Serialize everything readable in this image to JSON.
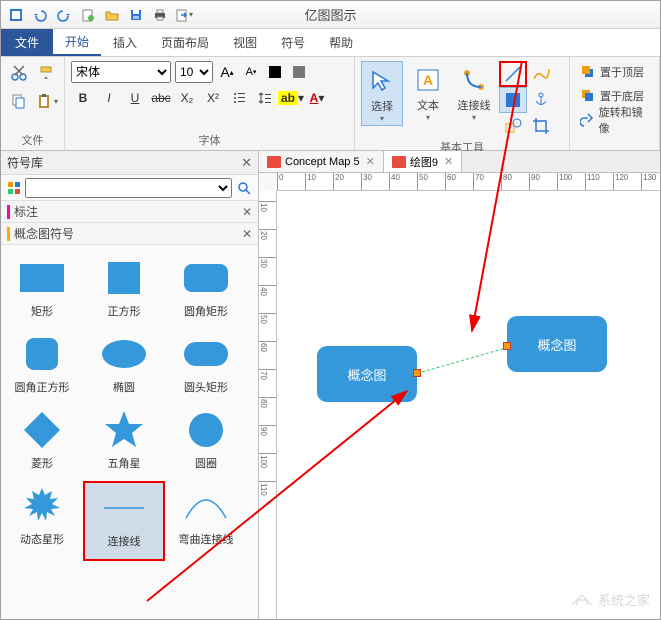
{
  "app_title": "亿图图示",
  "qat": [
    "app-menu",
    "undo",
    "redo",
    "new",
    "open",
    "save",
    "print",
    "export"
  ],
  "tabs": {
    "file": "文件",
    "items": [
      "开始",
      "插入",
      "页面布局",
      "视图",
      "符号",
      "帮助"
    ],
    "active": 0
  },
  "ribbon": {
    "clipboard": {
      "label": "文件"
    },
    "font": {
      "label": "字体",
      "name": "宋体",
      "size": "10",
      "btns": [
        "B",
        "I",
        "U",
        "abc",
        "X₂",
        "X²"
      ]
    },
    "tools": {
      "label": "基本工具",
      "select": "选择",
      "text": "文本",
      "connector": "连接线"
    },
    "arrange": {
      "top": "置于顶层",
      "bottom": "置于底层",
      "rotate": "旋转和镜像"
    }
  },
  "leftpanel": {
    "title": "符号库",
    "search_placeholder": "",
    "section1": "标注",
    "section2": "概念图符号",
    "shapes": [
      {
        "name": "rect",
        "label": "矩形"
      },
      {
        "name": "square",
        "label": "正方形"
      },
      {
        "name": "round-rect",
        "label": "圆角矩形"
      },
      {
        "name": "round-square",
        "label": "圆角正方形"
      },
      {
        "name": "ellipse",
        "label": "椭圆"
      },
      {
        "name": "round-head-rect",
        "label": "圆头矩形"
      },
      {
        "name": "diamond",
        "label": "菱形"
      },
      {
        "name": "star",
        "label": "五角星"
      },
      {
        "name": "circle",
        "label": "圆圈"
      },
      {
        "name": "dynamic-star",
        "label": "动态星形"
      },
      {
        "name": "line",
        "label": "连接线"
      },
      {
        "name": "curve",
        "label": "弯曲连接线"
      }
    ]
  },
  "docs": [
    {
      "name": "Concept Map 5",
      "active": false
    },
    {
      "name": "绘图9",
      "active": true
    }
  ],
  "ruler_h": [
    0,
    10,
    20,
    30,
    40,
    50,
    60,
    70,
    80,
    90,
    100,
    110,
    120,
    130
  ],
  "ruler_v": [
    10,
    20,
    30,
    40,
    50,
    60,
    70,
    80,
    90,
    100,
    110
  ],
  "canvas": {
    "node1": "概念图",
    "node2": "概念图"
  },
  "watermark": "系统之家"
}
